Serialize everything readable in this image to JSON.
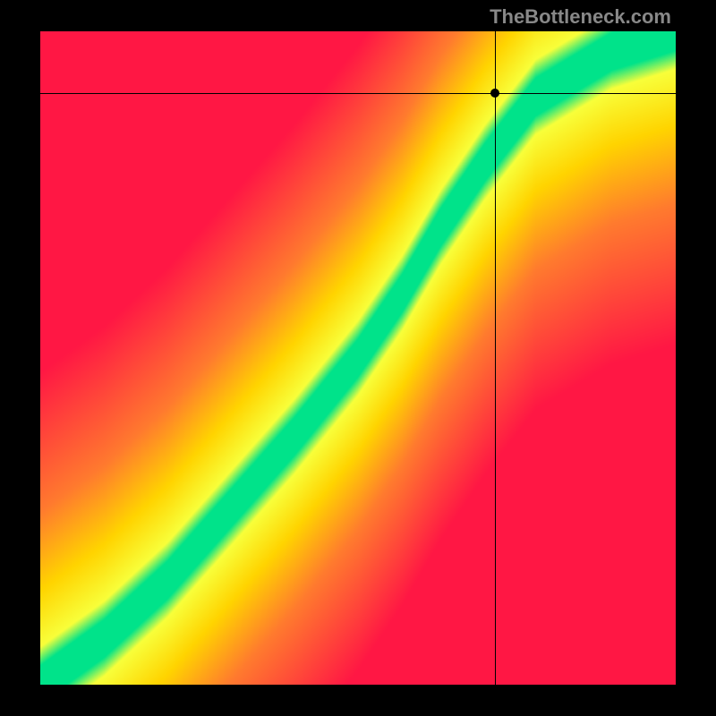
{
  "watermark": "TheBottleneck.com",
  "chart_data": {
    "type": "heatmap",
    "title": "",
    "xlabel": "",
    "ylabel": "",
    "xlim": [
      0,
      1
    ],
    "ylim": [
      0,
      1
    ],
    "crosshair": {
      "x": 0.715,
      "y": 0.905
    },
    "optimal_band": {
      "description": "Green S-curve band indicating balanced region; heatmap gradient from red (far from curve) through orange/yellow to green (on curve)",
      "curve_points_xy": [
        [
          0.0,
          0.0
        ],
        [
          0.1,
          0.07
        ],
        [
          0.2,
          0.16
        ],
        [
          0.3,
          0.27
        ],
        [
          0.4,
          0.38
        ],
        [
          0.5,
          0.5
        ],
        [
          0.57,
          0.6
        ],
        [
          0.63,
          0.7
        ],
        [
          0.7,
          0.8
        ],
        [
          0.78,
          0.9
        ],
        [
          0.9,
          0.97
        ],
        [
          1.0,
          1.0
        ]
      ],
      "band_half_width": 0.04
    },
    "colors": {
      "far": "#ff1744",
      "mid_far": "#ff7b2e",
      "mid": "#ffd400",
      "near": "#f8ff3a",
      "optimal": "#00e38a"
    }
  }
}
